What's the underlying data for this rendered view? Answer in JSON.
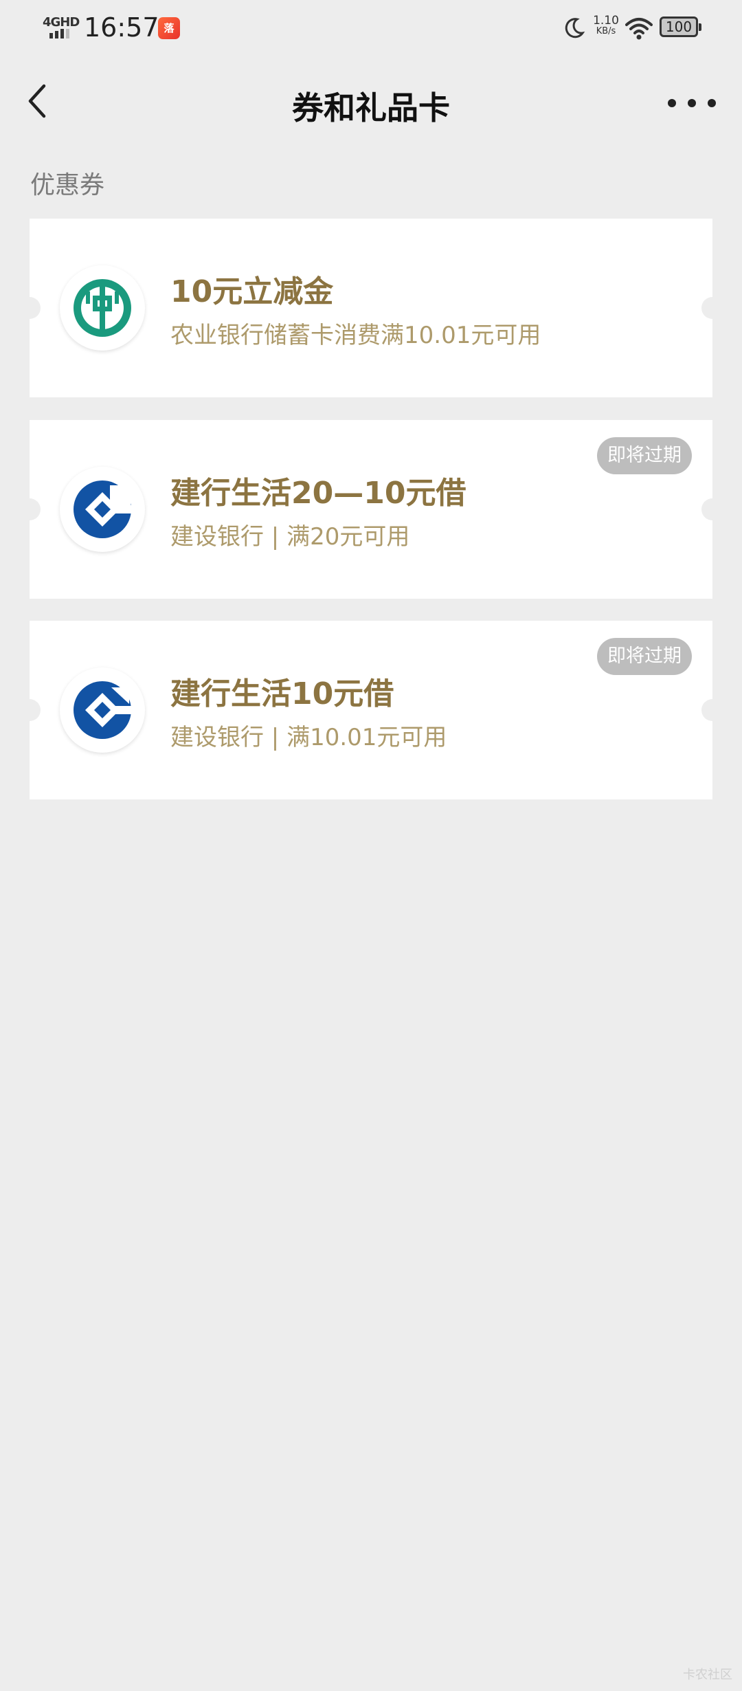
{
  "status_bar": {
    "network": "4GHD",
    "time": "16:57",
    "app_icon_text": "落",
    "speed_value": "1.10",
    "speed_unit": "KB/s",
    "battery": "100"
  },
  "nav": {
    "title": "券和礼品卡",
    "back_icon": "chevron-left-icon",
    "more_icon": "more-dots-icon"
  },
  "section": {
    "label": "优惠券"
  },
  "coupons": [
    {
      "title": "10元立减金",
      "desc": "农业银行储蓄卡消费满10.01元可用",
      "badge": "",
      "logo": "abc-bank-logo"
    },
    {
      "title": "建行生活20—10元借",
      "desc": "建设银行 | 满20元可用",
      "badge": "即将过期",
      "logo": "ccb-bank-logo"
    },
    {
      "title": "建行生活10元借",
      "desc": "建设银行 | 满10.01元可用",
      "badge": "即将过期",
      "logo": "ccb-bank-logo"
    }
  ],
  "colors": {
    "background": "#ededed",
    "coupon_title": "#8c7441",
    "coupon_desc": "#ad9a6b",
    "badge_bg": "#bdbdbd",
    "abc_green": "#1a9a7e",
    "ccb_blue": "#1253a4"
  },
  "watermark": "卡农社区"
}
